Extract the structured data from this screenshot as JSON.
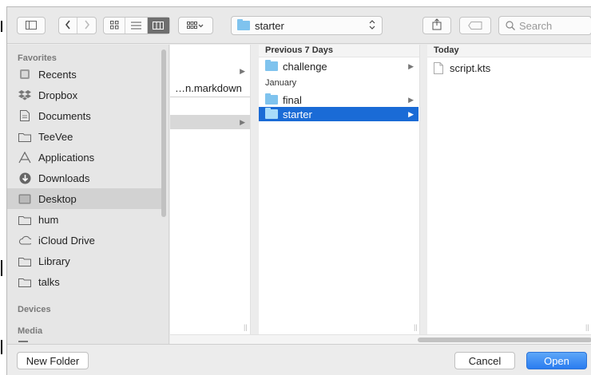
{
  "toolbar": {
    "path_label": "starter",
    "search_placeholder": "Search"
  },
  "sidebar": {
    "favorites_header": "Favorites",
    "items": [
      {
        "label": "Recents",
        "icon": "recents-icon"
      },
      {
        "label": "Dropbox",
        "icon": "dropbox-icon"
      },
      {
        "label": "Documents",
        "icon": "documents-icon"
      },
      {
        "label": "TeeVee",
        "icon": "folder-icon"
      },
      {
        "label": "Applications",
        "icon": "applications-icon"
      },
      {
        "label": "Downloads",
        "icon": "downloads-icon"
      },
      {
        "label": "Desktop",
        "icon": "desktop-icon"
      },
      {
        "label": "hum",
        "icon": "folder-icon"
      },
      {
        "label": "iCloud Drive",
        "icon": "cloud-icon"
      },
      {
        "label": "Library",
        "icon": "folder-icon"
      },
      {
        "label": "talks",
        "icon": "folder-icon"
      }
    ],
    "selected": "Desktop",
    "devices_header": "Devices",
    "media_header": "Media"
  },
  "column1": {
    "items": [
      {
        "label": "",
        "arrow": true
      },
      {
        "label": "…n.markdown",
        "arrow": false
      },
      {
        "label": "",
        "arrow": true
      }
    ]
  },
  "column2": {
    "header": "Previous 7 Days",
    "items_recent": [
      {
        "label": "challenge"
      }
    ],
    "group_january": "January",
    "items_january": [
      {
        "label": "final"
      },
      {
        "label": "starter"
      }
    ],
    "selected": "starter"
  },
  "column3": {
    "header": "Today",
    "items": [
      {
        "label": "script.kts"
      }
    ]
  },
  "buttons": {
    "new_folder": "New Folder",
    "cancel": "Cancel",
    "open": "Open"
  },
  "colors": {
    "selection": "#1a6bd6",
    "folder": "#7fc3ee",
    "open_button": "#2a7cf0"
  }
}
